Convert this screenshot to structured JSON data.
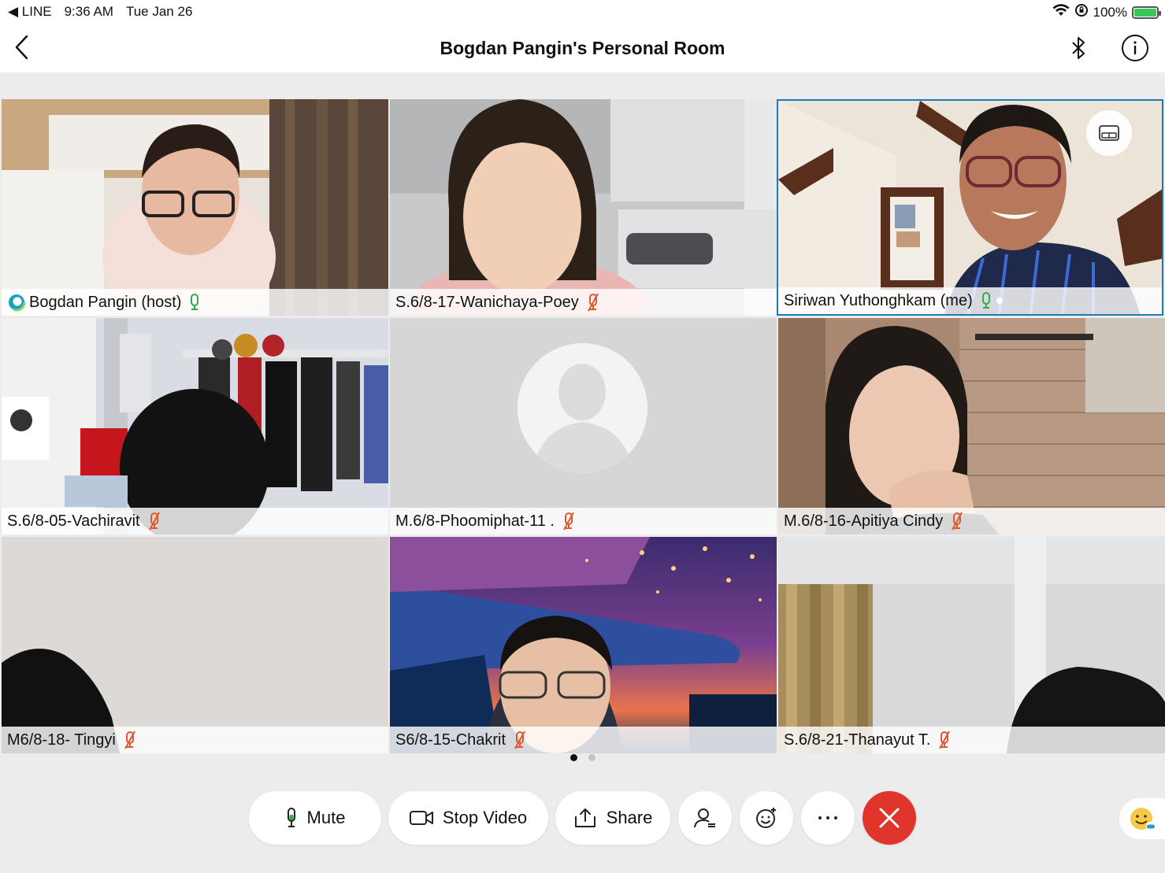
{
  "status_bar": {
    "back_app": "◀ LINE",
    "time": "9:36 AM",
    "date": "Tue Jan 26",
    "battery": "100%",
    "battery_level": 1.0
  },
  "header": {
    "title": "Bogdan Pangin's Personal Room"
  },
  "participants": [
    {
      "name": "Bogdan Pangin (host)",
      "muted": false,
      "host": true
    },
    {
      "name": "S.6/8-17-Wanichaya-Poey",
      "muted": true
    },
    {
      "name": "Siriwan Yuthonghkam (me)",
      "muted": false,
      "me": true
    },
    {
      "name": "S.6/8-05-Vachiravit",
      "muted": true
    },
    {
      "name": "M.6/8-Phoomiphat-11 .",
      "muted": true,
      "video_off": true
    },
    {
      "name": "M.6/8-16-Apitiya Cindy",
      "muted": true
    },
    {
      "name": "M6/8-18- Tingyi",
      "muted": true
    },
    {
      "name": "S6/8-15-Chakrit",
      "muted": true
    },
    {
      "name": "S.6/8-21-Thanayut T.",
      "muted": true
    }
  ],
  "pagination": {
    "current": 1,
    "total": 2
  },
  "toolbar": {
    "mute_label": "Mute",
    "stop_video_label": "Stop Video",
    "share_label": "Share"
  },
  "colors": {
    "accent": "#1d7ab7",
    "mic_active": "#2fa84f",
    "mic_muted": "#e0572b",
    "end_call": "#e0352b",
    "battery": "#34c759"
  }
}
